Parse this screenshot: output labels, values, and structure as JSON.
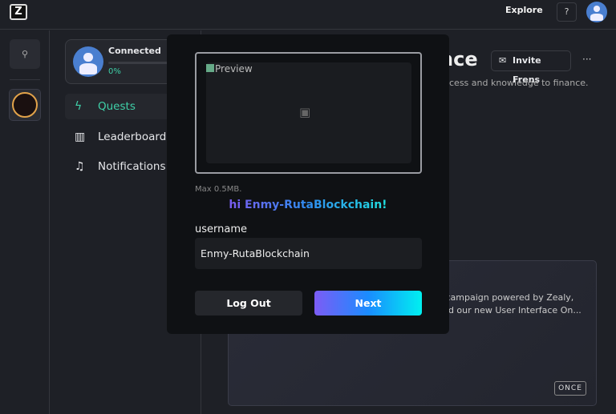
{
  "topbar": {
    "logo": "Z",
    "explore": "Explore",
    "help": "?"
  },
  "rail": {
    "search_icon": "search-icon"
  },
  "sidebar": {
    "status": "Connected",
    "progress_percent": 0,
    "progress_label": "0%",
    "items": [
      {
        "label": "Quests",
        "icon": "lightning-icon",
        "active": true
      },
      {
        "label": "Leaderboard",
        "icon": "leaderboard-icon"
      },
      {
        "label": "Notifications",
        "icon": "bell-icon"
      }
    ]
  },
  "background": {
    "title_fragment": "nce",
    "invite": "Invite Frens",
    "more": "···",
    "desc_fragment": "cess and knowledge to finance.",
    "quest_line1": "n campaign powered by Zealy,",
    "quest_line2": "und our new User Interface On...",
    "badge": "ONCE"
  },
  "modal": {
    "preview_alt": "Preview",
    "max_size": "Max 0.5MB.",
    "greeting": "hi Enmy-RutaBlockchain!",
    "username_label": "username",
    "username_value": "Enmy-RutaBlockchain",
    "logout": "Log Out",
    "next": "Next"
  },
  "colors": {
    "accent": "#3fd0a8",
    "gradient_start": "#7c5cf5",
    "gradient_end": "#00f0f0"
  }
}
